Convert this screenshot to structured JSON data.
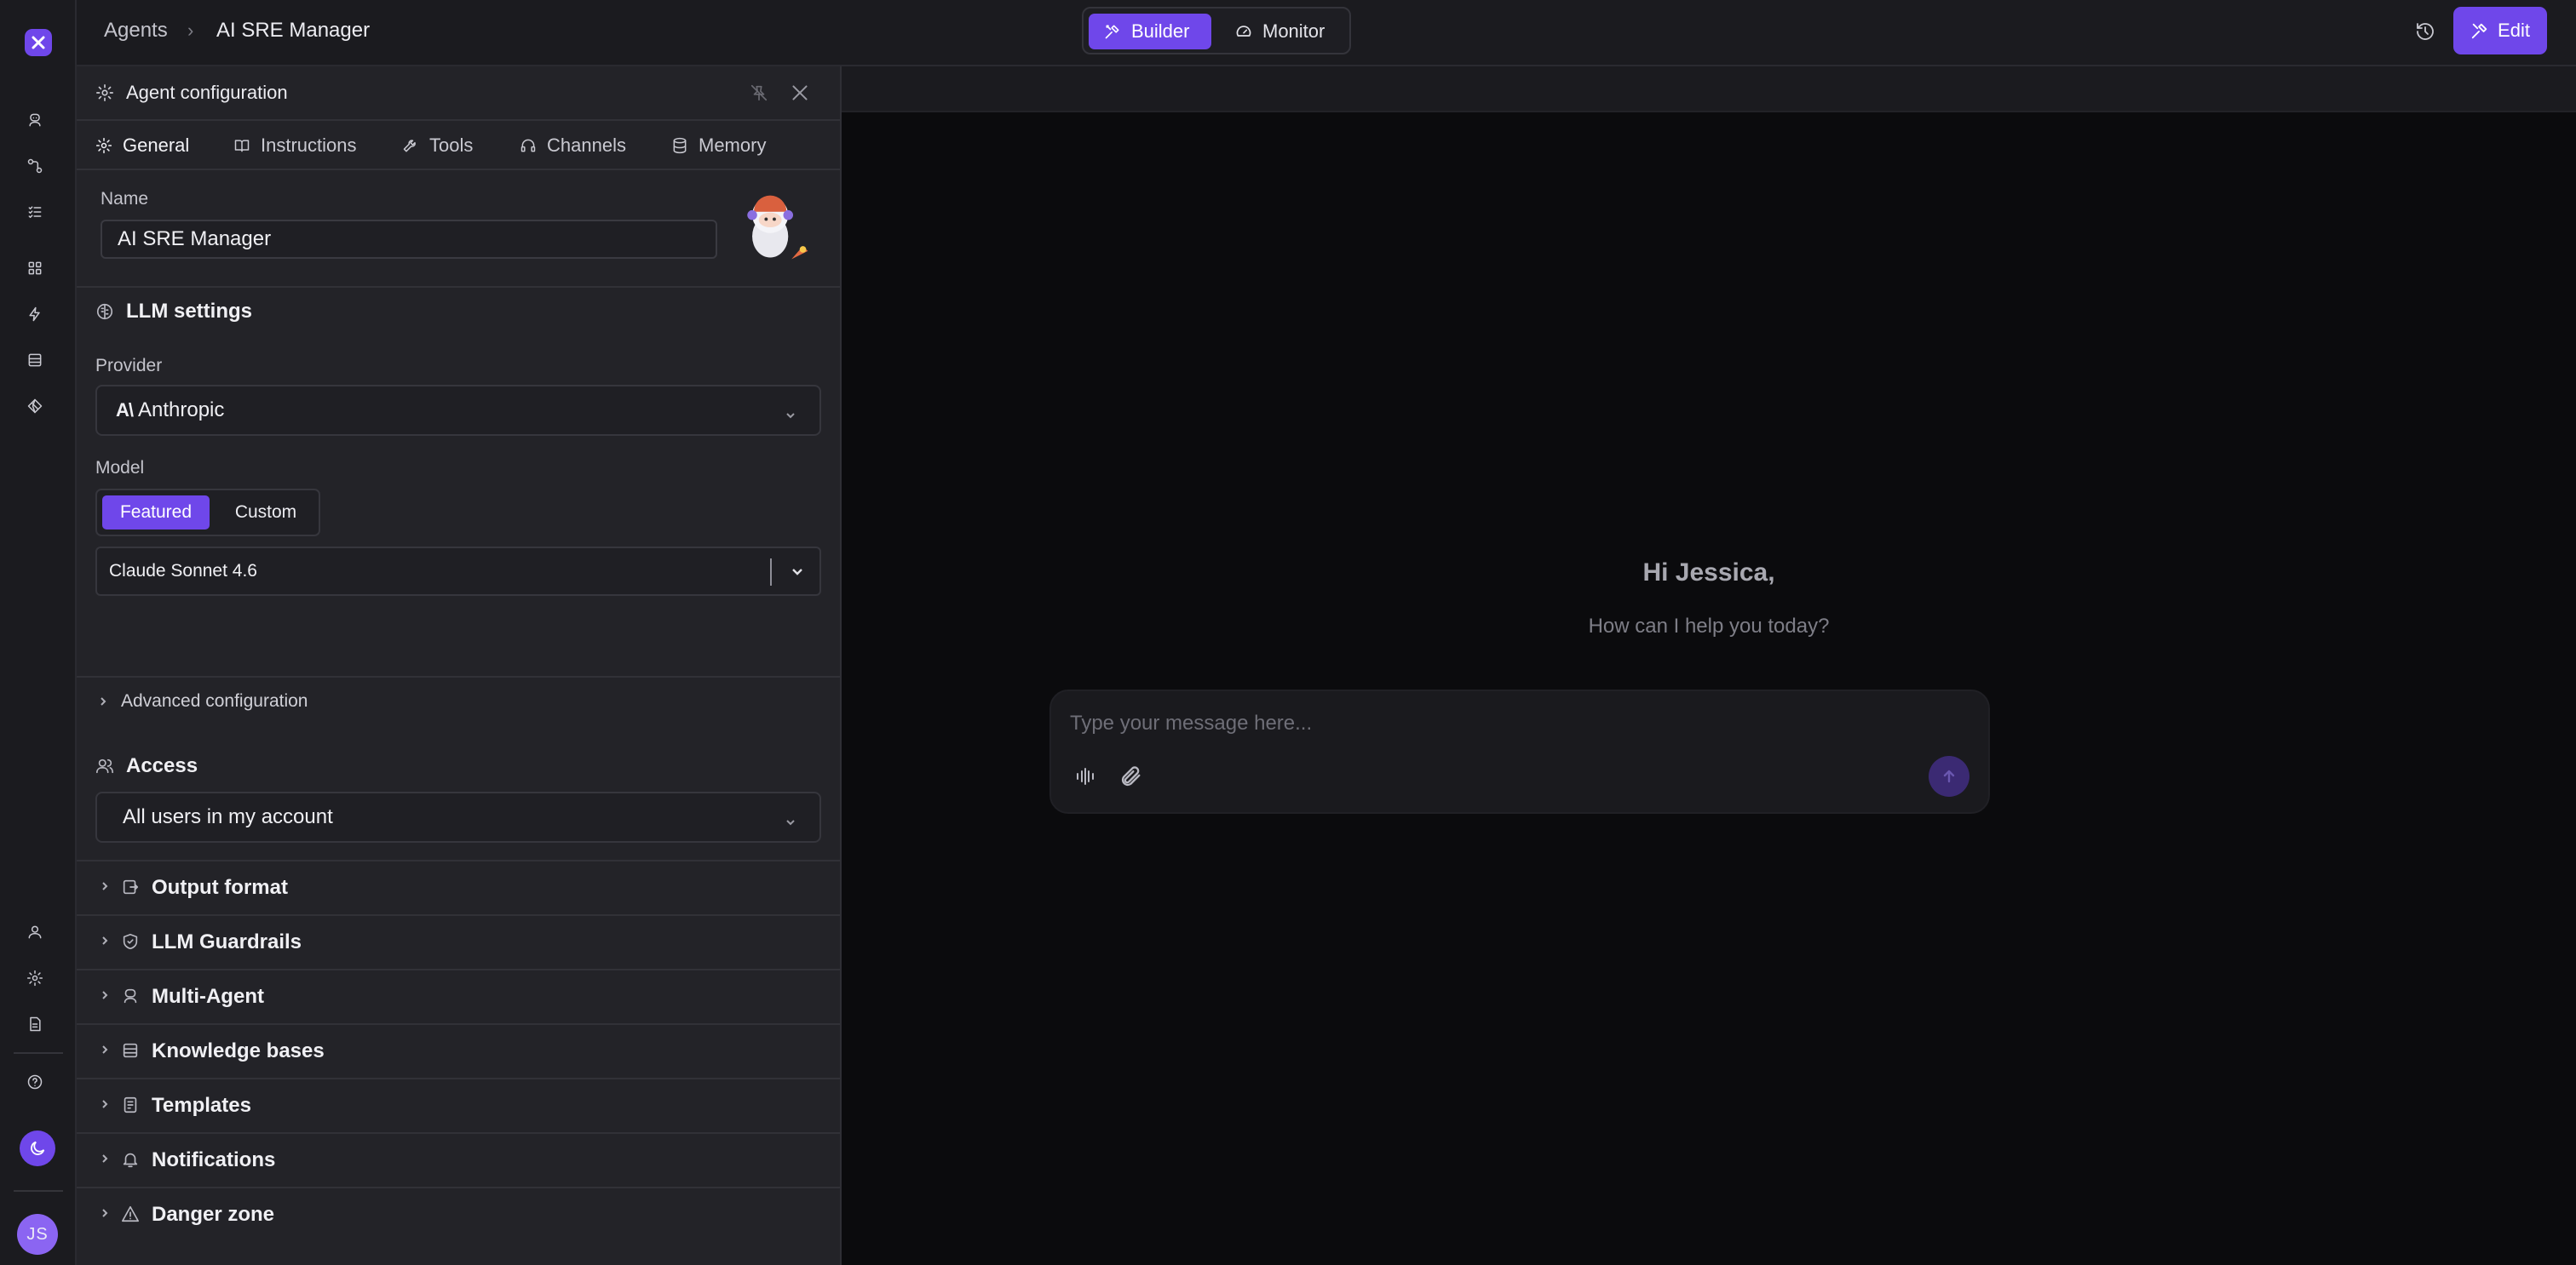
{
  "breadcrumb": {
    "parent": "Agents",
    "separator": "›",
    "current": "AI SRE Manager"
  },
  "mode_switch": {
    "builder_label": "Builder",
    "monitor_label": "Monitor",
    "active": "Builder"
  },
  "header_actions": {
    "edit_label": "Edit",
    "history_icon": "history-icon"
  },
  "user": {
    "initials": "JS"
  },
  "rail_icons": [
    "agents-icon",
    "workflows-icon",
    "tasks-icon",
    "apps-icon",
    "actions-icon",
    "datastore-icon",
    "integrations-icon",
    "user-icon",
    "settings-icon",
    "docs-icon",
    "help-icon",
    "theme-icon"
  ],
  "panel": {
    "title": "Agent configuration",
    "tabs": [
      {
        "label": "General",
        "icon": "gear-icon",
        "active": true
      },
      {
        "label": "Instructions",
        "icon": "book-icon",
        "active": false
      },
      {
        "label": "Tools",
        "icon": "wrench-icon",
        "active": false
      },
      {
        "label": "Channels",
        "icon": "headset-icon",
        "active": false
      },
      {
        "label": "Memory",
        "icon": "database-icon",
        "active": false
      }
    ],
    "name_label": "Name",
    "name_value": "AI SRE Manager",
    "llm_section": "LLM settings",
    "provider_label": "Provider",
    "provider_logo": "A\\",
    "provider_value": "Anthropic",
    "model_label": "Model",
    "model_modes": {
      "featured": "Featured",
      "custom": "Custom",
      "active": "Featured"
    },
    "model_value": "Claude Sonnet 4.6",
    "advanced_label": "Advanced configuration",
    "access_section": "Access",
    "access_value": "All users in my account",
    "collapsibles": [
      {
        "label": "Output format",
        "icon": "export-icon"
      },
      {
        "label": "LLM Guardrails",
        "icon": "shield-icon"
      },
      {
        "label": "Multi-Agent",
        "icon": "agents-icon"
      },
      {
        "label": "Knowledge bases",
        "icon": "database-icon"
      },
      {
        "label": "Templates",
        "icon": "template-icon"
      },
      {
        "label": "Notifications",
        "icon": "bell-icon"
      },
      {
        "label": "Danger zone",
        "icon": "warning-icon"
      }
    ]
  },
  "chat": {
    "greeting": "Hi Jessica,",
    "subtitle": "How can I help you today?",
    "placeholder": "Type your message here..."
  },
  "colors": {
    "accent": "#6f47ea",
    "panel_bg": "#232328",
    "chat_bg": "#0b0b0d"
  }
}
